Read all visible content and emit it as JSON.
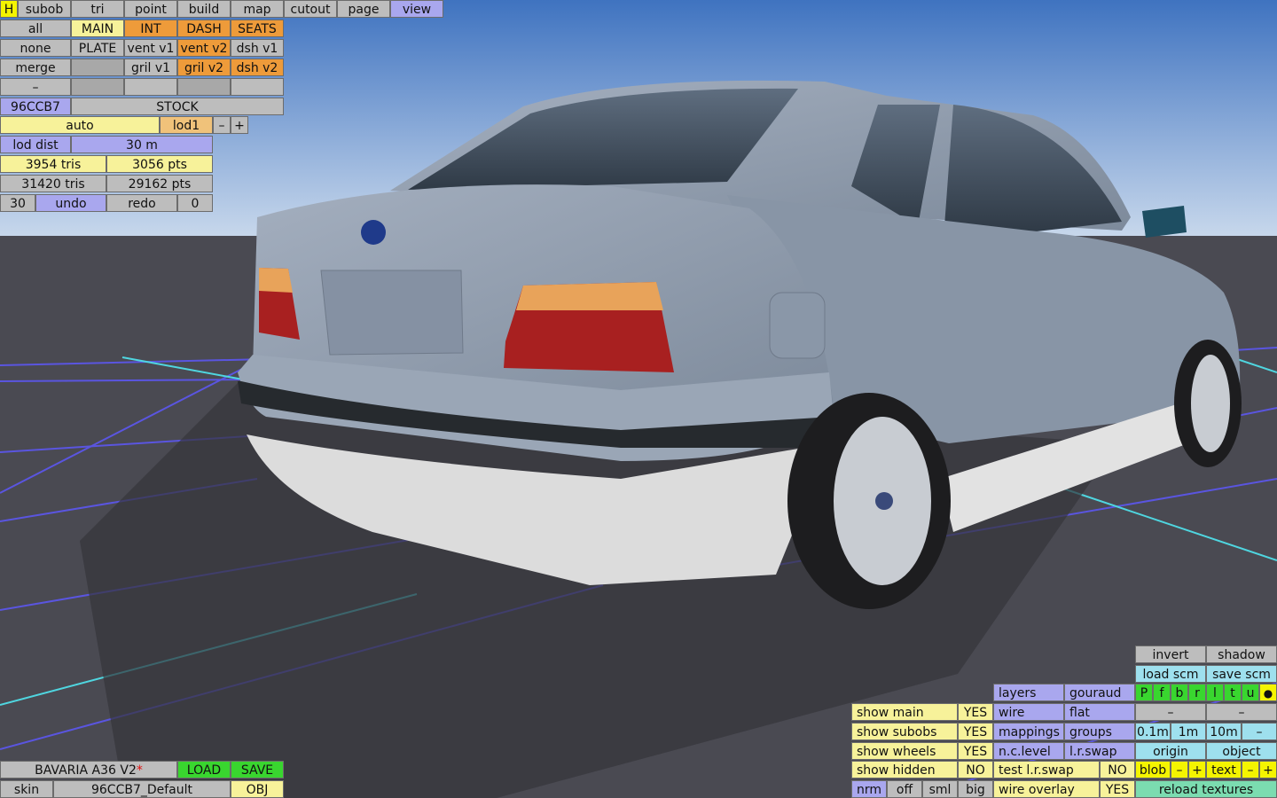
{
  "viewport": {
    "model_name": "BAVARIA A36 V2",
    "colors": {
      "sky_top": "#3f73c0",
      "sky_bottom": "#c8d8ec",
      "ground": "#4a4a52",
      "car_body": "#8d9aaa",
      "grid": "#5a55e0",
      "axis": "#4fd6e0"
    }
  },
  "top_menu": [
    "H",
    "subob",
    "tri",
    "point",
    "build",
    "map",
    "cutout",
    "page",
    "view"
  ],
  "subobj_rows": [
    [
      "all",
      "MAIN",
      "INT",
      "DASH",
      "SEATS"
    ],
    [
      "none",
      "PLATE",
      "vent v1",
      "vent v2",
      "dsh v1"
    ],
    [
      "merge",
      "",
      "gril v1",
      "gril v2",
      "dsh v2"
    ],
    [
      "–",
      "",
      "",
      "",
      ""
    ]
  ],
  "color_code": "96CCB7",
  "config_name": "STOCK",
  "lod": {
    "mode": "auto",
    "level": "lod1",
    "minus": "–",
    "plus": "+",
    "dist_label": "lod dist",
    "dist_value": "30 m"
  },
  "stats": {
    "tris": "3954 tris",
    "pts": "3056 pts",
    "total_tris": "31420 tris",
    "total_pts": "29162 pts"
  },
  "undo_row": {
    "count": "30",
    "undo": "undo",
    "redo": "redo",
    "redo_count": "0"
  },
  "bottom_left": {
    "model": "BAVARIA A36 V2",
    "modified_mark": "*",
    "load": "LOAD",
    "save": "SAVE",
    "skin_label": "skin",
    "skin_value": "96CCB7_Default",
    "obj": "OBJ"
  },
  "show_panel": [
    {
      "label": "show main",
      "value": "YES"
    },
    {
      "label": "show subobs",
      "value": "YES"
    },
    {
      "label": "show wheels",
      "value": "YES"
    },
    {
      "label": "show hidden",
      "value": "NO"
    }
  ],
  "normals": {
    "nrm": "nrm",
    "off": "off",
    "sml": "sml",
    "big": "big"
  },
  "view_options": {
    "layers": "layers",
    "gouraud": "gouraud",
    "wire": "wire",
    "flat": "flat",
    "mappings": "mappings",
    "groups": "groups",
    "nclevel": "n.c.level",
    "lrswap": "l.r.swap",
    "test_lrswap": "test l.r.swap",
    "test_lrswap_value": "NO",
    "wire_overlay": "wire overlay",
    "wire_overlay_value": "YES"
  },
  "right_panel": {
    "invert": "invert",
    "shadow": "shadow",
    "load_scm": "load scm",
    "save_scm": "save scm",
    "flags": [
      "P",
      "f",
      "b",
      "r",
      "l",
      "t",
      "u"
    ],
    "flag_dot": "●",
    "dash1": "–",
    "dash2": "–",
    "dist": [
      "0.1m",
      "1m",
      "10m"
    ],
    "dist_minus": "–",
    "origin": "origin",
    "object": "object",
    "blob": "blob",
    "text": "text",
    "minus": "–",
    "plus": "+",
    "reload": "reload textures"
  }
}
